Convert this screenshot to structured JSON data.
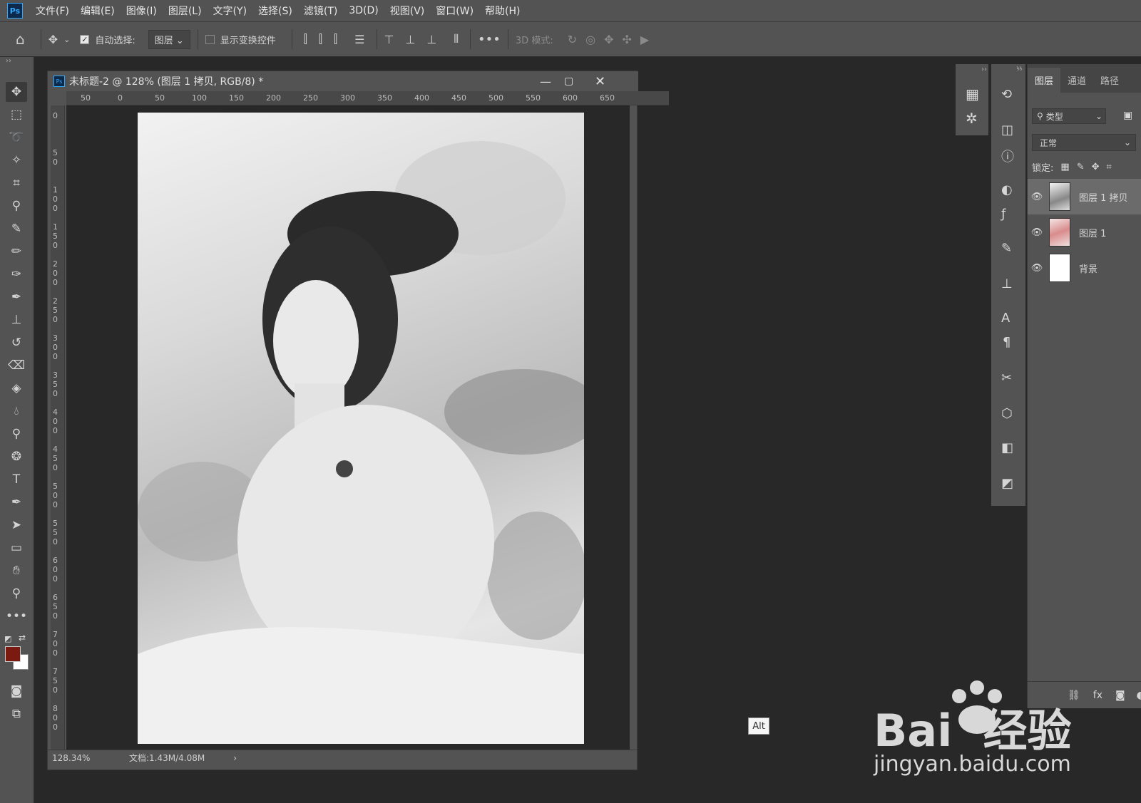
{
  "app": {
    "logo": "Ps"
  },
  "menu": [
    "文件(F)",
    "编辑(E)",
    "图像(I)",
    "图层(L)",
    "文字(Y)",
    "选择(S)",
    "滤镜(T)",
    "3D(D)",
    "视图(V)",
    "窗口(W)",
    "帮助(H)"
  ],
  "options": {
    "auto_select_label": "自动选择:",
    "auto_select_value": "图层",
    "show_transform_label": "显示变换控件",
    "mode_3d_label": "3D 模式:"
  },
  "document": {
    "title": "未标题-2 @ 128% (图层 1 拷贝, RGB/8) *",
    "zoom": "128.34%",
    "doc_size": "文档:1.43M/4.08M",
    "ruler_h": [
      "50",
      "0",
      "50",
      "100",
      "150",
      "200",
      "250",
      "300",
      "350",
      "400",
      "450",
      "500",
      "550",
      "600",
      "650"
    ],
    "ruler_v": [
      "0",
      "5 0",
      "1 0 0",
      "1 5 0",
      "2 0 0",
      "2 5 0",
      "3 0 0",
      "3 5 0",
      "4 0 0",
      "4 5 0",
      "5 0 0",
      "5 5 0",
      "6 0 0",
      "6 5 0",
      "7 0 0",
      "7 5 0",
      "8 0 0"
    ]
  },
  "layers_panel": {
    "tabs": [
      "图层",
      "通道",
      "路径"
    ],
    "filter_label": "类型",
    "blend_mode": "正常",
    "lock_label": "锁定:",
    "layers": [
      {
        "name": "图层 1 拷贝",
        "selected": true
      },
      {
        "name": "图层 1",
        "selected": false
      },
      {
        "name": "背景",
        "selected": false
      }
    ]
  },
  "colors": {
    "foreground": "#7a1a10",
    "background": "#ffffff",
    "accent": "#31a8ff"
  },
  "alt_badge": "Alt",
  "watermark": {
    "brand": "Bai  经验",
    "url": "jingyan.baidu.com"
  }
}
